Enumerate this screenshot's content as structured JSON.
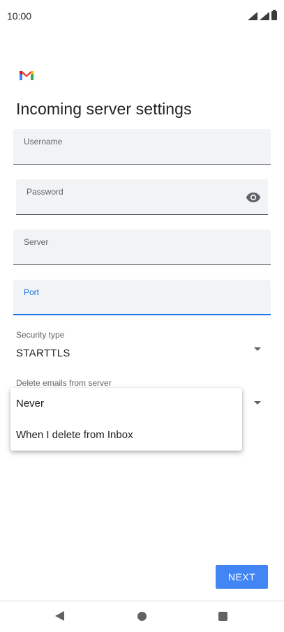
{
  "status_bar": {
    "time": "10:00"
  },
  "header": {
    "title": "Incoming server settings"
  },
  "fields": {
    "username": {
      "label": "Username",
      "value": ""
    },
    "password": {
      "label": "Password",
      "value": ""
    },
    "server": {
      "label": "Server",
      "value": ""
    },
    "port": {
      "label": "Port",
      "value": ""
    }
  },
  "security": {
    "label": "Security type",
    "value": "STARTTLS"
  },
  "delete_emails": {
    "label": "Delete emails from server",
    "options": [
      "Never",
      "When I delete from Inbox"
    ]
  },
  "actions": {
    "next_label": "NEXT"
  },
  "colors": {
    "accent": "#4285f4",
    "focus": "#1a73e8"
  },
  "icons": {
    "status": [
      "signal-icon",
      "signal-icon",
      "battery-icon"
    ],
    "logo": "gmail-logo-icon",
    "password_toggle": "eye-icon",
    "dropdown": "caret-down-icon",
    "nav": [
      "back-icon",
      "home-icon",
      "recents-icon"
    ]
  }
}
